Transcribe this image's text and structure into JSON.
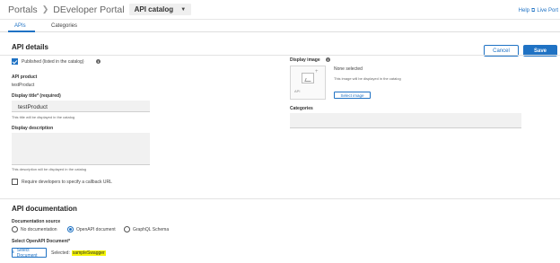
{
  "header": {
    "crumbs": [
      "Portals",
      "DEveloper Portal"
    ],
    "catalog_select": "API catalog",
    "help": "Help",
    "live_portal": "Live Port"
  },
  "tabs": [
    {
      "label": "APIs",
      "active": true
    },
    {
      "label": "Categories",
      "active": false
    }
  ],
  "api_details": {
    "title": "API details",
    "cancel_label": "Cancel",
    "save_label": "Save",
    "published_label": "Published (listed in the catalog)",
    "published_checked": true,
    "api_product_label": "API product",
    "api_product_value": "testProduct",
    "display_title_label": "Display title* (required)",
    "display_title_value": "testProduct",
    "display_title_hint": "This title will be displayed in the catalog",
    "display_description_label": "Display description",
    "display_description_value": "",
    "display_description_hint": "This description will be displayed in the catalog",
    "callback_label": "Require developers to specify a callback URL",
    "callback_checked": false,
    "display_image_label": "Display image",
    "image_api_text": "API",
    "none_selected": "None selected",
    "image_hint": "This image will be displayed in the catalog",
    "select_image_label": "Select image",
    "categories_label": "Categories"
  },
  "api_documentation": {
    "title": "API documentation",
    "source_label": "Documentation source",
    "options": [
      {
        "label": "No documentation",
        "selected": false
      },
      {
        "label": "OpenAPI document",
        "selected": true
      },
      {
        "label": "GraphQL Schema",
        "selected": false
      }
    ],
    "select_doc_label": "Select OpenAPI Document*",
    "select_doc_button": "Select Document",
    "selected_prefix": "Selected:",
    "selected_value": "sampleSwagger"
  },
  "colors": {
    "accent": "#1f72c4",
    "highlight": "#f5f500"
  },
  "icons": [
    "chevron-right-icon",
    "chevron-down-icon",
    "external-link-icon",
    "info-icon",
    "image-placeholder-icon",
    "upload-icon"
  ]
}
